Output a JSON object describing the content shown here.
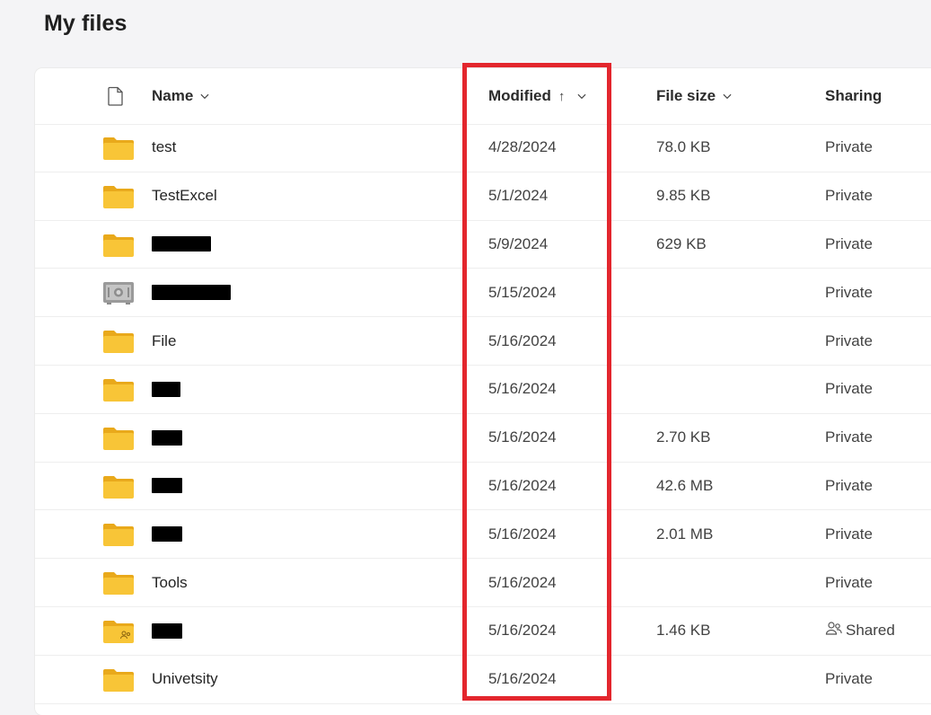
{
  "page": {
    "title": "My files"
  },
  "header": {
    "name": "Name",
    "modified": "Modified",
    "modified_sort_arrow": "↑",
    "file_size": "File size",
    "sharing": "Sharing"
  },
  "rows": [
    {
      "icon": "folder-icon",
      "name": "test",
      "redacted": false,
      "modified": "4/28/2024",
      "size": "78.0 KB",
      "sharing": "Private"
    },
    {
      "icon": "folder-icon",
      "name": "TestExcel",
      "redacted": false,
      "modified": "5/1/2024",
      "size": "9.85 KB",
      "sharing": "Private"
    },
    {
      "icon": "folder-icon",
      "name": "",
      "redacted": true,
      "modified": "5/9/2024",
      "size": "629 KB",
      "sharing": "Private"
    },
    {
      "icon": "vault-icon",
      "name": "",
      "redacted": true,
      "modified": "5/15/2024",
      "size": "",
      "sharing": "Private"
    },
    {
      "icon": "folder-icon",
      "name": "File",
      "redacted": false,
      "modified": "5/16/2024",
      "size": "",
      "sharing": "Private"
    },
    {
      "icon": "folder-icon",
      "name": "",
      "redacted": true,
      "modified": "5/16/2024",
      "size": "",
      "sharing": "Private"
    },
    {
      "icon": "folder-icon",
      "name": "",
      "redacted": true,
      "modified": "5/16/2024",
      "size": "2.70 KB",
      "sharing": "Private"
    },
    {
      "icon": "folder-icon",
      "name": "",
      "redacted": true,
      "modified": "5/16/2024",
      "size": "42.6 MB",
      "sharing": "Private"
    },
    {
      "icon": "folder-icon",
      "name": "",
      "redacted": true,
      "modified": "5/16/2024",
      "size": "2.01 MB",
      "sharing": "Private"
    },
    {
      "icon": "folder-icon",
      "name": "Tools",
      "redacted": false,
      "modified": "5/16/2024",
      "size": "",
      "sharing": "Private"
    },
    {
      "icon": "shared-folder-icon",
      "name": "",
      "redacted": true,
      "modified": "5/16/2024",
      "size": "1.46 KB",
      "sharing": "Shared",
      "sharing_icon": "people-icon"
    },
    {
      "icon": "folder-icon",
      "name": "Univetsity",
      "redacted": false,
      "modified": "5/16/2024",
      "size": "",
      "sharing": "Private"
    }
  ],
  "colors": {
    "folder": "#f8c537",
    "folder_back": "#e9a91b",
    "highlight": "#e3262d",
    "background": "#f4f4f6"
  }
}
